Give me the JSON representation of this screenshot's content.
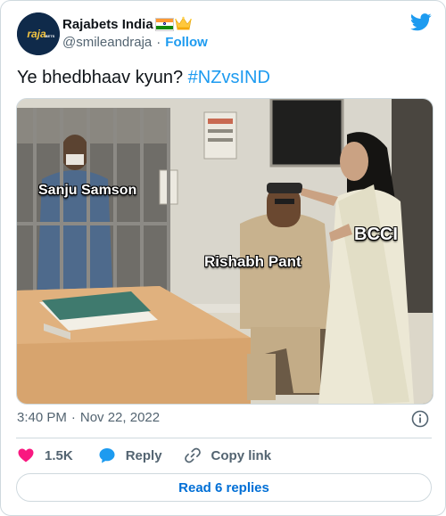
{
  "author": {
    "display_name": "Rajabets India",
    "handle": "@smileandraja",
    "separator": "·",
    "follow_label": "Follow",
    "avatar_text": "raja",
    "avatar_subtext": "BETS",
    "emoji": [
      "indian-flag",
      "crown"
    ]
  },
  "tweet": {
    "text_plain": "Ye bhedbhaav kyun? ",
    "hashtag": "#NZvsIND"
  },
  "media": {
    "labels": {
      "left": "Sanju Samson",
      "center": "Rishabh Pant",
      "right": "BCCI"
    }
  },
  "meta": {
    "time": "3:40 PM",
    "separator": "·",
    "date": "Nov 22, 2022"
  },
  "actions": {
    "likes": "1.5K",
    "reply_label": "Reply",
    "copy_label": "Copy link"
  },
  "read_replies_label": "Read 6 replies",
  "colors": {
    "accent": "#1d9bf0",
    "like": "#f91880",
    "muted": "#536471",
    "text": "#0f1419",
    "border": "#cfd9de"
  }
}
